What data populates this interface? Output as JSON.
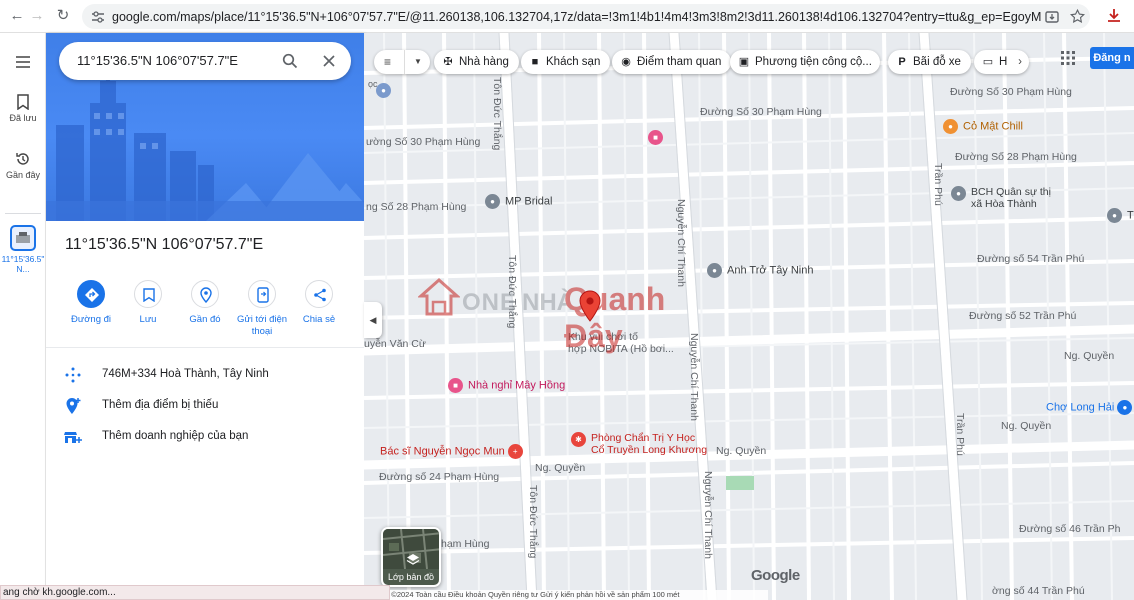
{
  "browser": {
    "url": "google.com/maps/place/11°15'36.5\"N+106°07'57.7\"E/@11.260138,106.132704,17z/data=!3m1!4b1!4m4!3m3!8m2!3d11.260138!4d106.132704?entry=ttu&g_ep=EgoyMDI0MTAyMi4wIKXMD..."
  },
  "rail": {
    "saved_label": "Đã lưu",
    "recent_label": "Gần đây",
    "current_label": "11°15'36.5\" N..."
  },
  "search": {
    "value": "11°15'36.5\"N 106°07'57.7\"E"
  },
  "place": {
    "title": "11°15'36.5\"N 106°07'57.7\"E",
    "actions": [
      {
        "label": "Đường đi",
        "icon": "directions-icon"
      },
      {
        "label": "Lưu",
        "icon": "bookmark-icon"
      },
      {
        "label": "Gần đó",
        "icon": "nearby-icon"
      },
      {
        "label": "Gửi tới điện thoại",
        "icon": "send-to-phone-icon"
      },
      {
        "label": "Chia sẻ",
        "icon": "share-icon"
      }
    ],
    "plus_code": "746M+334 Hoà Thành, Tây Ninh",
    "add_missing_place": "Thêm địa điểm bị thiếu",
    "add_business": "Thêm doanh nghiệp của bạn"
  },
  "map": {
    "chips": [
      {
        "label": "Nhà hàng",
        "icon": "restaurant-icon"
      },
      {
        "label": "Khách sạn",
        "icon": "hotel-icon"
      },
      {
        "label": "Điểm tham quan",
        "icon": "camera-icon"
      },
      {
        "label": "Phương tiện công cộ...",
        "icon": "transit-icon"
      },
      {
        "label": "Bãi đỗ xe",
        "icon": "parking-icon"
      },
      {
        "label": "H",
        "icon": "pharmacy-icon"
      }
    ],
    "login_label": "Đăng n",
    "layer_label": "Lớp bản đồ",
    "google_logo": "Google",
    "watermark_one": "ONE",
    "watermark_house": "NHÀ",
    "watermark_red": "Quanh Đây",
    "streets": {
      "s30_top": "Đường Số 30 Phạm Hùng",
      "s30_left": "ường Số 30 Phạm Hùng",
      "s28_left": "ng Số 28 Phạm Hùng",
      "s28_right": "Đường Số 28 Phạm Hùng",
      "s30_right": "Đường Số 30 Phạm Hùng",
      "s54": "Đường số 54 Trần Phú",
      "s52": "Đường số 52 Trần Phú",
      "s24": "Đường số 24 Phạm Hùng",
      "s46": "Đường số 46 Trần Ph",
      "s44": "ờng số 44 Trần Phú",
      "nguyen_van_cu": "uyễn Văn Cừ",
      "ng_quyen_left": "Ng. Quyền",
      "ng_quyen_mid": "Ng. Quyền",
      "ng_quyen_r1": "Ng. Quyền",
      "ng_quyen_r2": "Ng. Quyền",
      "pham_hung": "hạm Hùng",
      "ton_duc_thang_top": "Tôn Đức Thắng",
      "ton_duc_thang_mid": "Tôn Đức Thắng",
      "ton_duc_thang_bot": "Tôn Đức Thắng",
      "nguyen_chi_thanh_1": "Nguyễn Chí Thanh",
      "nguyen_chi_thanh_2": "Nguyễn Chí Thanh",
      "nguyen_chi_thanh_3": "Nguyễn Chí Thanh",
      "tran_phu_1": "Trần Phú",
      "tran_phu_2": "Trần Phú",
      "top_left_frag": "ọc"
    },
    "pois": {
      "mp_bridal": "MP Bridal",
      "anh_tro": "Anh Trở Tây Ninh",
      "co_mat_chill": "Cỏ Mật Chill",
      "bch_line1": "BCH Quân sự thị",
      "bch_line2": "xã Hòa Thành",
      "khu_vui_line1": "Khu vui chơi tố",
      "khu_vui_line2": "hợp NOBITA (Hồ bơi...",
      "nha_nghi": "Nhà nghỉ Mây Hồng",
      "cho_long_hai": "Chợ Long Hải",
      "bac_si": "Bác sĩ Nguyễn Ngọc Mun",
      "phong_chan_tri_line1": "Phòng Chẩn Trị Y Học",
      "phong_chan_tri_line2": "Cổ Truyền Long Khương",
      "right_edge_t": "T"
    },
    "footer": "Dữ liệu bản đồ ©2024    Toàn cầu    Điều khoản    Quyền riêng tư    Gửi ý kiến phản hồi về sản phẩm    100 mét"
  },
  "status": "ang chờ kh.google.com..."
}
